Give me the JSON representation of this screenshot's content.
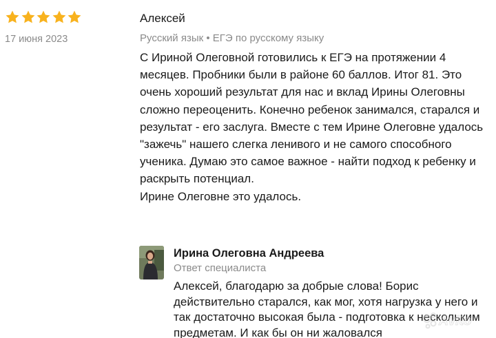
{
  "review": {
    "rating": 5,
    "star_color": "#f8b21e",
    "date": "17 июня 2023",
    "author": "Алексей",
    "subject": "Русский язык • ЕГЭ по русскому языку",
    "paragraphs": [
      "С Ириной Олеговной готовились к ЕГЭ на протяжении 4 месяцев. Пробники были в районе 60 баллов. Итог 81. Это очень хороший результат для нас и вклад Ирины Олеговны сложно переоценить. Конечно ребенок занимался, старался и результат - его заслуга. Вместе с тем Ирине Олеговне удалось \"зажечь\" нашего слегка ленивого и не самого способного ученика. Думаю это самое важное - найти подход к ребенку и раскрыть потенциал.",
      "Ирине Олеговне это удалось."
    ]
  },
  "reply": {
    "name": "Ирина Олеговна Андреева",
    "role": "Ответ специалиста",
    "text": "Алексей, благодарю за добрые слова! Борис действительно старался, как мог, хотя нагрузка у него и так достаточно высокая была - подготовка к нескольким предметам. И как бы он ни жаловался"
  },
  "watermark": {
    "text": "Avito"
  }
}
